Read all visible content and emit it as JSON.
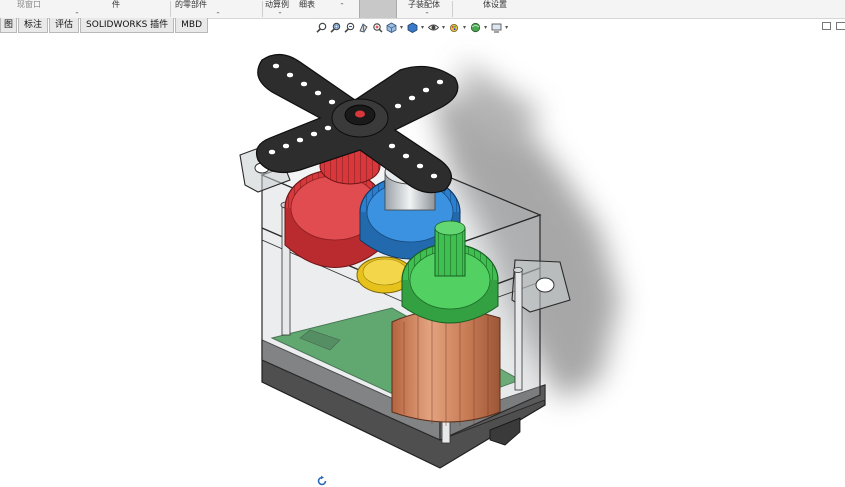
{
  "ribbon": {
    "items": [
      {
        "label": "现窗口",
        "sub": ""
      },
      {
        "label": "件",
        "sub": "-"
      },
      {
        "label": "的零部件",
        "sub": "-"
      },
      {
        "label": "动算例",
        "sub": "-"
      },
      {
        "label": "细表",
        "sub": ""
      },
      {
        "label": "",
        "sub": "-"
      },
      {
        "label": "子装配体",
        "sub": "-"
      },
      {
        "label": "体设置",
        "sub": ""
      }
    ]
  },
  "tabs": [
    "图",
    "标注",
    "评估",
    "SOLIDWORKS 插件",
    "MBD"
  ],
  "hud_icons": [
    "zoom-to-fit-icon",
    "zoom-area-icon",
    "previous-view-icon",
    "section-view-icon",
    "dynamic-annotation-icon",
    "view-orientation-icon",
    "display-style-icon",
    "hide-show-items-icon",
    "edit-appearance-icon",
    "apply-scene-icon",
    "view-settings-icon"
  ],
  "model": {
    "colors": {
      "housing": "#b9bfc4",
      "horn": "#2d2d2d",
      "red_gear": "#d8373b",
      "blue_gear": "#2a7fd0",
      "yellow_gear": "#e8c21c",
      "green_gear": "#3fbf4f",
      "motor": "#c77b55",
      "pcb": "#3fa050",
      "shadow": "#8a8a8a"
    }
  }
}
